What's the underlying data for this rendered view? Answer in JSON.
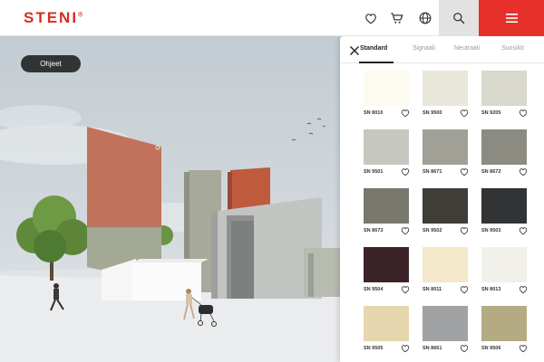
{
  "brand": {
    "logo_text": "STENI",
    "logo_mark": "®",
    "accent": "#e5312a"
  },
  "header": {
    "icons": [
      "heart-icon",
      "cart-icon",
      "globe-icon",
      "search-icon",
      "hamburger-menu-icon"
    ]
  },
  "scene": {
    "guide_button_label": "Ohjeet"
  },
  "panel": {
    "tabs": [
      {
        "label": "Standard",
        "active": true
      },
      {
        "label": "Signaali",
        "active": false
      },
      {
        "label": "Neutraali",
        "active": false
      },
      {
        "label": "Suosikit",
        "active": false
      }
    ],
    "swatches": [
      {
        "code": "SN 8010",
        "color": "#fdfbef"
      },
      {
        "code": "SN 9500",
        "color": "#e9e6da"
      },
      {
        "code": "SN 9205",
        "color": "#d9d8cd"
      },
      {
        "code": "SN 9501",
        "color": "#c6c8c0"
      },
      {
        "code": "SN 8671",
        "color": "#a1a097"
      },
      {
        "code": "SN 8672",
        "color": "#8c8b82"
      },
      {
        "code": "SN 8673",
        "color": "#78786f"
      },
      {
        "code": "SN 9502",
        "color": "#3f3d38"
      },
      {
        "code": "SN 9503",
        "color": "#313335"
      },
      {
        "code": "SN 9504",
        "color": "#3c2327"
      },
      {
        "code": "SN 8011",
        "color": "#f3e8c9"
      },
      {
        "code": "SN 8013",
        "color": "#f1f0ea"
      },
      {
        "code": "SN 9505",
        "color": "#e6d6ad"
      },
      {
        "code": "SN 8661",
        "color": "#a0a2a3"
      },
      {
        "code": "SN 9506",
        "color": "#b4ab82"
      }
    ]
  }
}
